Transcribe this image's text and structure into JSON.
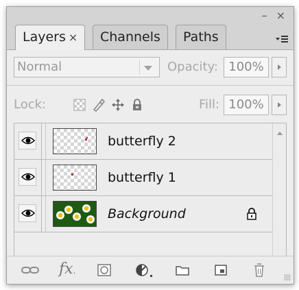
{
  "window": {
    "minimize_glyph": "–",
    "close_glyph": "×"
  },
  "tabs": [
    {
      "label": "Layers",
      "active": true,
      "close_glyph": "×"
    },
    {
      "label": "Channels",
      "active": false
    },
    {
      "label": "Paths",
      "active": false
    }
  ],
  "blend_mode": {
    "value": "Normal"
  },
  "opacity": {
    "label": "Opacity:",
    "value": "100%"
  },
  "lock": {
    "label": "Lock:"
  },
  "fill": {
    "label": "Fill:",
    "value": "100%"
  },
  "layers": [
    {
      "name": "butterfly 2",
      "visible": true,
      "italic": false,
      "locked": false
    },
    {
      "name": "butterfly 1",
      "visible": true,
      "italic": false,
      "locked": false
    },
    {
      "name": "Background",
      "visible": true,
      "italic": true,
      "locked": true
    }
  ],
  "footer_icons": [
    "link-layers-icon",
    "layer-style-fx-icon",
    "add-mask-icon",
    "adjustment-layer-icon",
    "new-group-icon",
    "new-layer-icon",
    "trash-icon"
  ],
  "footer": {
    "fx_label": "fx"
  },
  "colors": {
    "panel_bg": "#ededed",
    "tab_active": "#efefef",
    "tab_inactive": "#cfcfcf",
    "dim_text": "#a8a8a8"
  }
}
